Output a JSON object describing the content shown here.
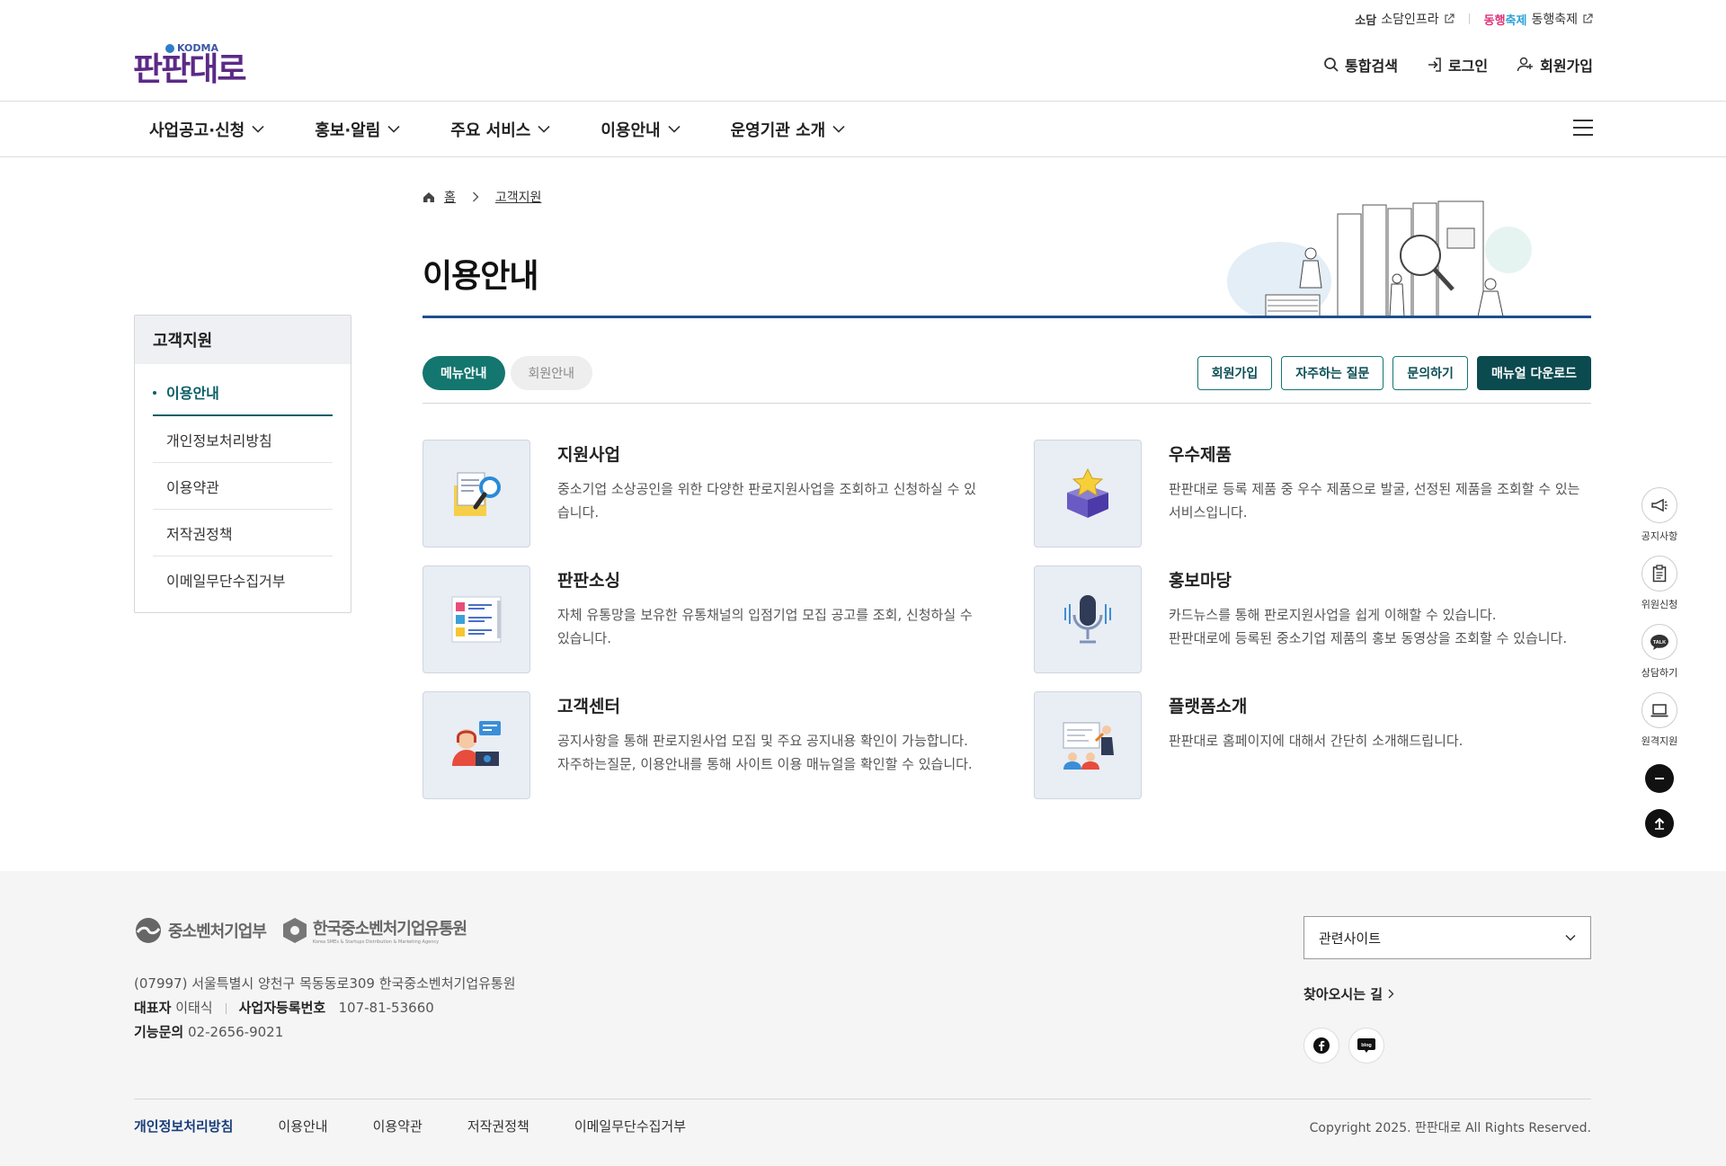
{
  "util": {
    "sodam_logo": "소담",
    "sodam_label": "소담인프라",
    "festa_logo_1": "동행",
    "festa_logo_2": "축제",
    "festa_label": "동행축제"
  },
  "logo": {
    "text": "판판대로",
    "kodma": "KODMA"
  },
  "top_actions": {
    "search": "통합검색",
    "login": "로그인",
    "signup": "회원가입"
  },
  "gnb": [
    {
      "label": "사업공고·신청"
    },
    {
      "label": "홍보·알림"
    },
    {
      "label": "주요 서비스"
    },
    {
      "label": "이용안내"
    },
    {
      "label": "운영기관 소개"
    }
  ],
  "lnb": {
    "title": "고객지원",
    "items": [
      {
        "label": "이용안내"
      },
      {
        "label": "개인정보처리방침"
      },
      {
        "label": "이용약관"
      },
      {
        "label": "저작권정책"
      },
      {
        "label": "이메일무단수집거부"
      }
    ]
  },
  "breadcrumb": {
    "home": "홈",
    "current": "고객지원"
  },
  "page_title": "이용안내",
  "tabs": [
    {
      "label": "메뉴안내"
    },
    {
      "label": "회원안내"
    }
  ],
  "buttons": {
    "signup": "회원가입",
    "faq": "자주하는 질문",
    "inquiry": "문의하기",
    "manual": "매뉴얼 다운로드"
  },
  "cards": [
    {
      "title": "지원사업",
      "desc": [
        "중소기업 소상공인을 위한 다양한 판로지원사업을 조회하고 신청하실 수 있습니다."
      ],
      "icon": "document-search-icon"
    },
    {
      "title": "우수제품",
      "desc": [
        "판판대로 등록 제품 중 우수 제품으로 발굴, 선정된 제품을 조회할 수 있는 서비스입니다."
      ],
      "icon": "star-box-icon"
    },
    {
      "title": "판판소싱",
      "desc": [
        "자체 유통망을 보유한 유통채널의 입점기업 모집 공고를 조회, 신청하실 수 있습니다."
      ],
      "icon": "checklist-icon"
    },
    {
      "title": "홍보마당",
      "desc": [
        "카드뉴스를 통해 판로지원사업을 쉽게 이해할 수 있습니다.",
        "판판대로에 등록된 중소기업 제품의 홍보 동영상을 조회할 수 있습니다."
      ],
      "icon": "microphone-icon"
    },
    {
      "title": "고객센터",
      "desc": [
        "공지사항을 통해 판로지원사업 모집 및 주요 공지내용 확인이 가능합니다. 자주하는질문, 이용안내를 통해 사이트 이용 매뉴얼을 확인할 수 있습니다."
      ],
      "icon": "call-center-icon"
    },
    {
      "title": "플랫폼소개",
      "desc": [
        "판판대로 홈페이지에 대해서 간단히 소개해드립니다."
      ],
      "icon": "presentation-icon"
    }
  ],
  "quick_menu": [
    {
      "label": "공지사항",
      "icon": "megaphone-icon"
    },
    {
      "label": "위원신청",
      "icon": "clipboard-icon"
    },
    {
      "label": "상담하기",
      "icon": "talk-icon"
    },
    {
      "label": "원격지원",
      "icon": "laptop-icon"
    }
  ],
  "footer": {
    "logo_ministry": "중소벤처기업부",
    "logo_agency": "한국중소벤처기업유통원",
    "logo_agency_sub": "Korea SMEs & Startups Distribution & Marketing Agency",
    "address": "(07997) 서울특별시 양천구 목동동로309 한국중소벤처기업유통원",
    "ceo_label": "대표자",
    "ceo": "이태식",
    "bizno_label": "사업자등록번호",
    "bizno": "107-81-53660",
    "tech_label": "기능문의",
    "tech_phone": "02-2656-9021",
    "related_sites": "관련사이트",
    "directions": "찾아오시는 길",
    "links": [
      {
        "label": "개인정보처리방침"
      },
      {
        "label": "이용안내"
      },
      {
        "label": "이용약관"
      },
      {
        "label": "저작권정책"
      },
      {
        "label": "이메일무단수집거부"
      }
    ],
    "copyright": "Copyright 2025. 판판대로 All Rights Reserved."
  },
  "colors": {
    "accent": "#13766f",
    "accent_dark": "#0b4a4f",
    "title_line": "#1f4e8c",
    "logo": "#5b2a86"
  }
}
